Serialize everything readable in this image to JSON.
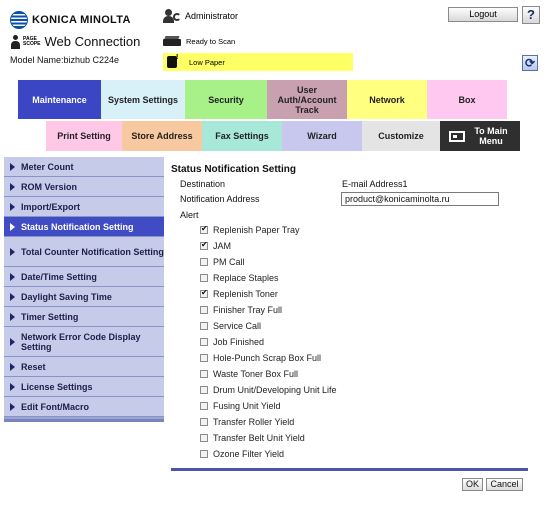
{
  "brand": {
    "name": "KONICA MINOLTA"
  },
  "pagescope": {
    "logo_line1": "PAGE",
    "logo_line2": "SCOPE",
    "title": "Web Connection"
  },
  "model_label": "Model Name:bizhub C224e",
  "user": {
    "name": "Administrator"
  },
  "logout_label": "Logout",
  "help_label": "?",
  "status": {
    "scan": "Ready to Scan",
    "paper": "Low Paper"
  },
  "main_tabs": [
    {
      "label": "Maintenance",
      "bg": "#3a46c4",
      "color": "#ffffff",
      "active": true
    },
    {
      "label": "System Settings",
      "bg": "#d8f0f8"
    },
    {
      "label": "Security",
      "bg": "#a8f088"
    },
    {
      "label": "User Auth/Account Track",
      "bg": "#c8a0b0"
    },
    {
      "label": "Network",
      "bg": "#ffff80"
    },
    {
      "label": "Box",
      "bg": "#ffc8f0"
    }
  ],
  "sub_tabs": [
    {
      "label": "Print Setting",
      "bg": "#ffc8e6"
    },
    {
      "label": "Store Address",
      "bg": "#f8c8a0"
    },
    {
      "label": "Fax Settings",
      "bg": "#a8e8d8"
    },
    {
      "label": "Wizard",
      "bg": "#c8c8ee"
    },
    {
      "label": "Customize",
      "bg": "#e4e4e4"
    },
    {
      "label": "To Main Menu",
      "bg": "#2f2f2f"
    }
  ],
  "sidebar": {
    "items": [
      {
        "label": "Meter Count"
      },
      {
        "label": "ROM Version"
      },
      {
        "label": "Import/Export"
      },
      {
        "label": "Status Notification Setting",
        "active": true
      },
      {
        "label": "Total Counter Notification Setting"
      },
      {
        "label": "Date/Time Setting"
      },
      {
        "label": "Daylight Saving Time"
      },
      {
        "label": "Timer Setting"
      },
      {
        "label": "Network Error Code Display Setting"
      },
      {
        "label": "Reset"
      },
      {
        "label": "License Settings"
      },
      {
        "label": "Edit Font/Macro"
      }
    ]
  },
  "content": {
    "title": "Status Notification Setting",
    "destination_label": "Destination",
    "destination_value": "E-mail Address1",
    "address_label": "Notification Address",
    "address_value": "product@konicaminolta.ru",
    "alert_label": "Alert",
    "alerts": [
      {
        "label": "Replenish Paper Tray",
        "checked": true
      },
      {
        "label": "JAM",
        "checked": true
      },
      {
        "label": "PM Call",
        "checked": false
      },
      {
        "label": "Replace Staples",
        "checked": false
      },
      {
        "label": "Replenish Toner",
        "checked": true
      },
      {
        "label": "Finisher Tray Full",
        "checked": false
      },
      {
        "label": "Service Call",
        "checked": false
      },
      {
        "label": "Job Finished",
        "checked": false
      },
      {
        "label": "Hole-Punch Scrap Box Full",
        "checked": false
      },
      {
        "label": "Waste Toner Box Full",
        "checked": false
      },
      {
        "label": "Drum Unit/Developing Unit Life",
        "checked": false
      },
      {
        "label": "Fusing Unit Yield",
        "checked": false
      },
      {
        "label": "Transfer Roller Yield",
        "checked": false
      },
      {
        "label": "Transfer Belt Unit Yield",
        "checked": false
      },
      {
        "label": "Ozone Filter Yield",
        "checked": false
      }
    ]
  },
  "buttons": {
    "ok": "OK",
    "cancel": "Cancel"
  },
  "icons": {
    "brand": "konica-globe-icon",
    "admin": "administrator-icon",
    "scan": "scanner-icon",
    "paper": "toner-warning-icon",
    "refresh": "refresh-icon",
    "main_menu": "main-menu-icon"
  }
}
